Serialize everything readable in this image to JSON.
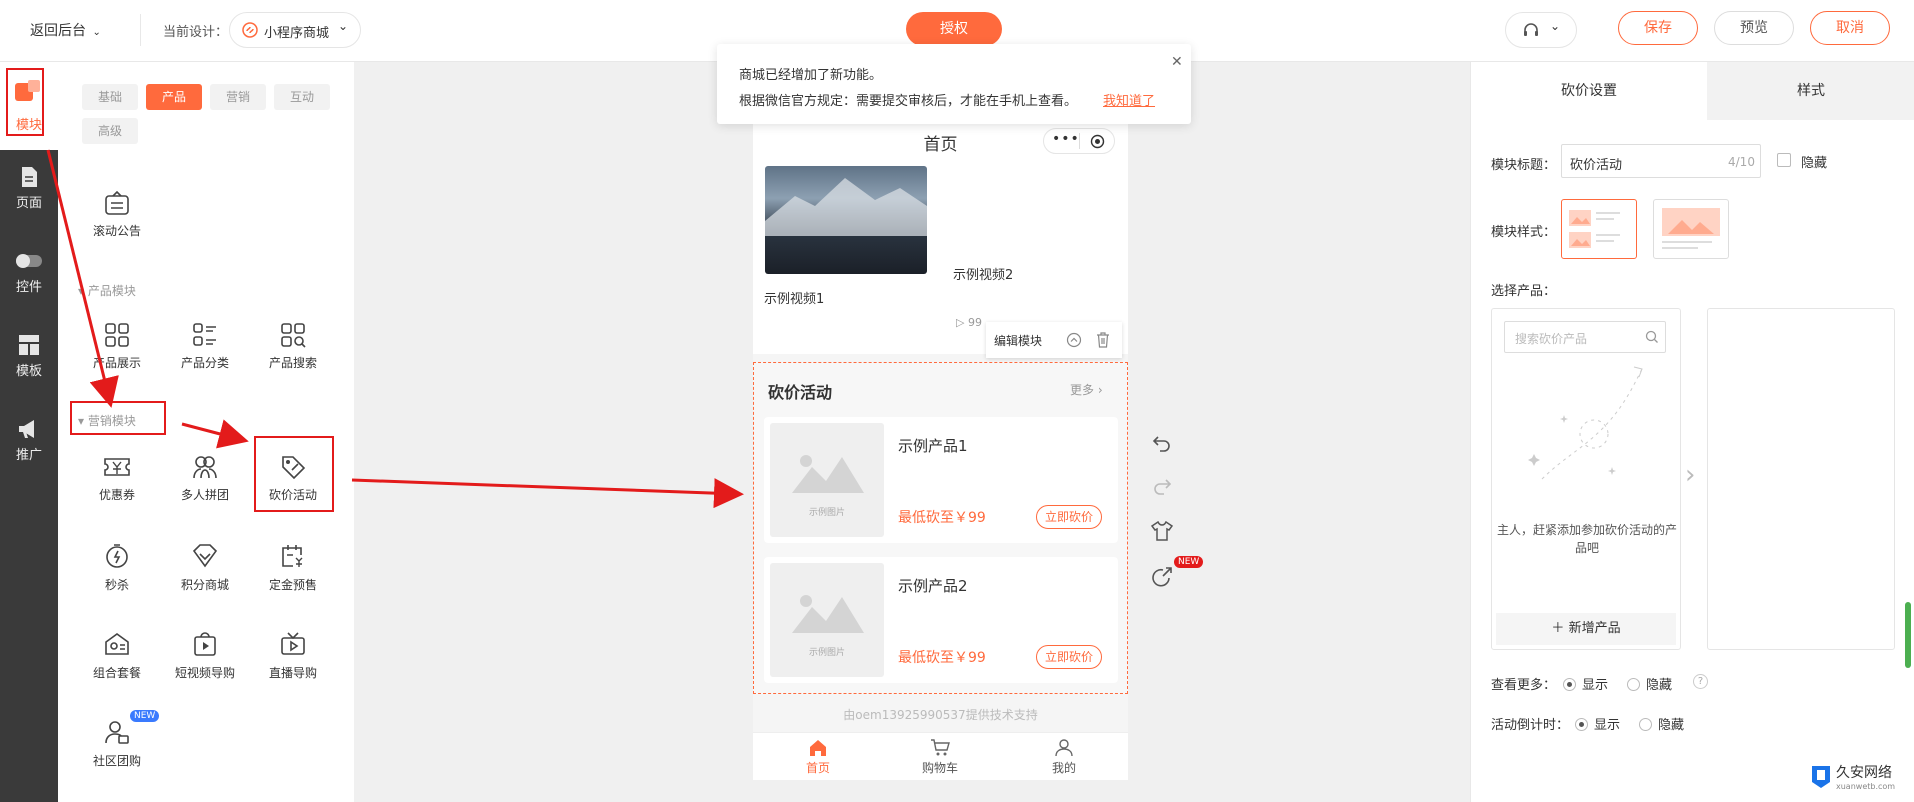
{
  "topbar": {
    "back_label": "返回后台",
    "design_prefix": "当前设计：",
    "design_name": "小程序商城",
    "auth_button": "授权",
    "save": "保存",
    "preview": "预览",
    "cancel": "取消"
  },
  "notice": {
    "line1": "商城已经增加了新功能。",
    "line2": "根据微信官方规定：需要提交审核后，才能在手机上查看。",
    "link": "我知道了"
  },
  "rail": {
    "items": [
      {
        "label": "模块"
      },
      {
        "label": "页面"
      },
      {
        "label": "控件"
      },
      {
        "label": "模板"
      },
      {
        "label": "推广"
      }
    ]
  },
  "panel": {
    "tabs": [
      "基础",
      "产品",
      "营销",
      "互动",
      "高级"
    ],
    "scroll_notice": "滚动公告",
    "section_product": "产品模块",
    "product_modules": [
      "产品展示",
      "产品分类",
      "产品搜索"
    ],
    "section_marketing": "营销模块",
    "marketing_modules": [
      "优惠券",
      "多人拼团",
      "砍价活动",
      "秒杀",
      "积分商城",
      "定金预售",
      "组合套餐",
      "短视频导购",
      "直播导购",
      "社区团购"
    ],
    "new_badge": "NEW"
  },
  "phone": {
    "title": "首页",
    "video1": "示例视频1",
    "video2": "示例视频2",
    "video_count": "99",
    "edit_module": "编辑模块",
    "bargain": {
      "title": "砍价活动",
      "more": "更多",
      "items": [
        {
          "name": "示例产品1",
          "price": "最低砍至￥99",
          "btn": "立即砍价",
          "img_label": "示例图片"
        },
        {
          "name": "示例产品2",
          "price": "最低砍至￥99",
          "btn": "立即砍价",
          "img_label": "示例图片"
        }
      ]
    },
    "footer": "由oem13925990537提供技术支持",
    "nav": [
      "首页",
      "购物车",
      "我的"
    ]
  },
  "side_tools": {
    "new_badge": "NEW"
  },
  "right": {
    "tabs": [
      "砍价设置",
      "样式"
    ],
    "title_label": "模块标题：",
    "title_value": "砍价活动",
    "title_count": "4/10",
    "hide_label": "隐藏",
    "style_label": "模块样式：",
    "select_label": "选择产品：",
    "search_placeholder": "搜索砍价产品",
    "empty_text": "主人，赶紧添加参加砍价活动的产品吧",
    "add_product": "新增产品",
    "more_label": "查看更多：",
    "show": "显示",
    "hide": "隐藏",
    "countdown_label": "活动倒计时：",
    "help": "?"
  },
  "watermark": {
    "brand": "久安网络",
    "url": "xuanwetb.com"
  },
  "colors": {
    "accent": "#ff6a3d",
    "rail": "#3a3a3a",
    "annotation": "#e31b1b"
  }
}
